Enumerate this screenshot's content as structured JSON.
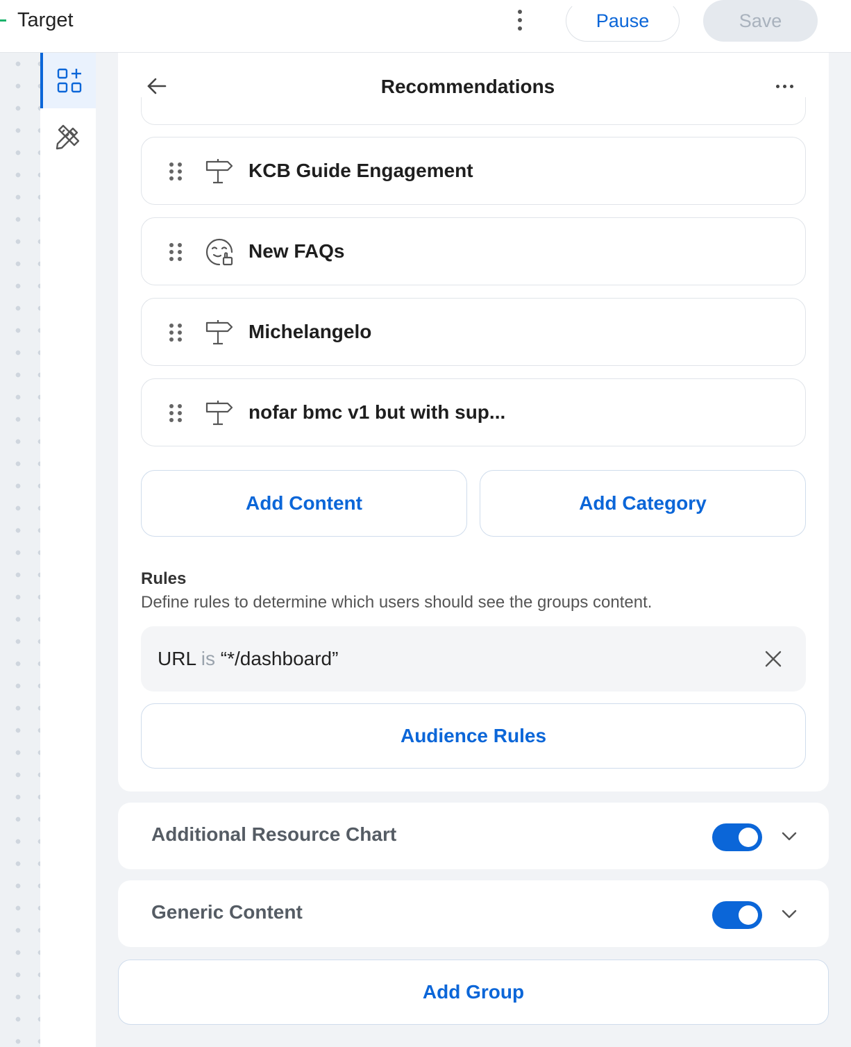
{
  "header": {
    "title": "Target",
    "pause_label": "Pause",
    "save_label": "Save"
  },
  "sidebar": {
    "items": [
      {
        "icon": "add-widget-icon",
        "active": true
      },
      {
        "icon": "design-tools-icon",
        "active": false
      }
    ]
  },
  "panel": {
    "title": "Recommendations",
    "items": [
      {
        "icon": "signpost-icon",
        "label": "KCB Guide Engagement"
      },
      {
        "icon": "faq-help-icon",
        "label": "New FAQs"
      },
      {
        "icon": "signpost-icon",
        "label": "Michelangelo"
      },
      {
        "icon": "signpost-icon",
        "label": "nofar bmc v1 but with sup..."
      }
    ],
    "add_content_label": "Add Content",
    "add_category_label": "Add Category",
    "rules": {
      "title": "Rules",
      "description": "Define rules to determine which users should see the groups content.",
      "rule": {
        "field": "URL",
        "operator": "is",
        "value": "“*/dashboard”"
      },
      "audience_label": "Audience Rules"
    }
  },
  "groups": [
    {
      "title": "Additional Resource Chart",
      "enabled": true
    },
    {
      "title": "Generic Content",
      "enabled": true
    }
  ],
  "add_group_label": "Add Group",
  "colors": {
    "accent": "#0b66d8",
    "toggle_on": "#0b66d8",
    "brand_green": "#1bb36b"
  }
}
